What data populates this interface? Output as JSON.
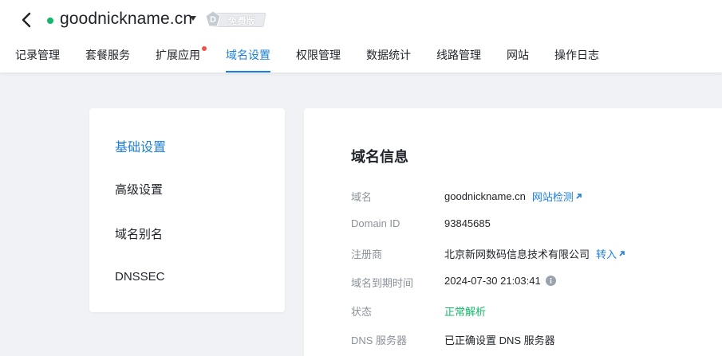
{
  "header": {
    "domain": "goodnickname.cn",
    "plan_badge": "免费版",
    "status_dot_color": "#14b86b",
    "accent_color": "#1d7fde"
  },
  "tabs": [
    {
      "label": "记录管理"
    },
    {
      "label": "套餐服务"
    },
    {
      "label": "扩展应用",
      "has_notice_dot": true
    },
    {
      "label": "域名设置",
      "active": true
    },
    {
      "label": "权限管理"
    },
    {
      "label": "数据统计"
    },
    {
      "label": "线路管理"
    },
    {
      "label": "网站"
    },
    {
      "label": "操作日志"
    }
  ],
  "sidebar": {
    "items": [
      {
        "label": "基础设置",
        "active": true
      },
      {
        "label": "高级设置"
      },
      {
        "label": "域名别名"
      },
      {
        "label": "DNSSEC"
      }
    ]
  },
  "domain_info": {
    "title": "域名信息",
    "rows": [
      {
        "label": "域名",
        "value": "goodnickname.cn",
        "link": "网站检测"
      },
      {
        "label": "Domain ID",
        "value": "93845685"
      },
      {
        "label": "注册商",
        "value": "北京新网数码信息技术有限公司",
        "link": "转入"
      },
      {
        "label": "域名到期时间",
        "value": "2024-07-30 21:03:41"
      },
      {
        "label": "状态",
        "value": "正常解析"
      },
      {
        "label": "DNS 服务器",
        "value": "已正确设置 DNS 服务器"
      }
    ]
  }
}
